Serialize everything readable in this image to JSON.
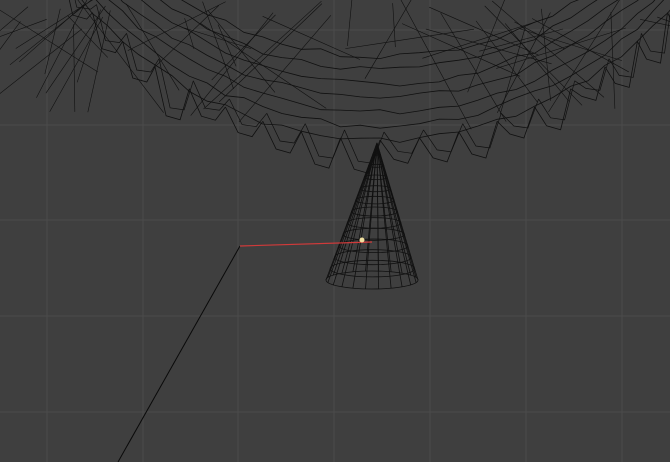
{
  "viewport": {
    "background_color": "#3f3f3f",
    "grid_color": "#4b4b4b",
    "wire_color": "#101010",
    "guide_line_color": "#0a0a0a",
    "x_axis_color": "#d03a3a",
    "origin_marker_color": "#f0e0a0",
    "grid_visible": true,
    "view_mode": "wireframe"
  }
}
